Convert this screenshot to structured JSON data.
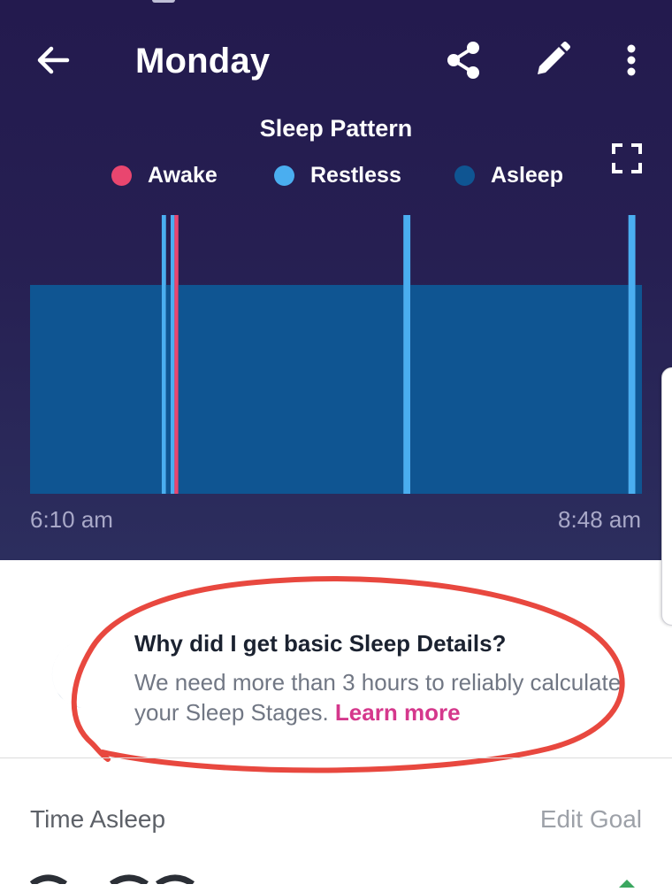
{
  "header": {
    "title": "Monday"
  },
  "chart_data": {
    "type": "bar",
    "title": "Sleep Pattern",
    "legend": [
      {
        "name": "Awake",
        "color": "#e9466f"
      },
      {
        "name": "Restless",
        "color": "#4aaef0"
      },
      {
        "name": "Asleep",
        "color": "#0f5592"
      }
    ],
    "x_start_label": "6:10 am",
    "x_end_label": "8:48 am",
    "x_range_minutes": [
      0,
      158
    ],
    "levels": {
      "Asleep": 1,
      "Restless": 2,
      "Awake": 2
    },
    "segments": [
      {
        "state": "Asleep",
        "start": 0,
        "end": 34
      },
      {
        "state": "Restless",
        "start": 34,
        "end": 35.1
      },
      {
        "state": "Asleep",
        "start": 35.1,
        "end": 36.3
      },
      {
        "state": "Restless",
        "start": 36.3,
        "end": 37.3
      },
      {
        "state": "Awake",
        "start": 37.3,
        "end": 38.3
      },
      {
        "state": "Asleep",
        "start": 38.3,
        "end": 96.4
      },
      {
        "state": "Restless",
        "start": 96.4,
        "end": 98.2
      },
      {
        "state": "Asleep",
        "start": 98.2,
        "end": 154.5
      },
      {
        "state": "Restless",
        "start": 154.5,
        "end": 156.3
      },
      {
        "state": "Asleep",
        "start": 156.3,
        "end": 158
      }
    ]
  },
  "info": {
    "title": "Why did I get basic Sleep Details?",
    "body": "We need more than 3 hours to reliably calculate your Sleep Stages. ",
    "link": "Learn more"
  },
  "summary": {
    "label": "Time Asleep",
    "edit_goal": "Edit Goal"
  },
  "colors": {
    "header_bg": "#241c4f",
    "accent_pink": "#d5388c",
    "annotation_red": "#e8483f"
  }
}
